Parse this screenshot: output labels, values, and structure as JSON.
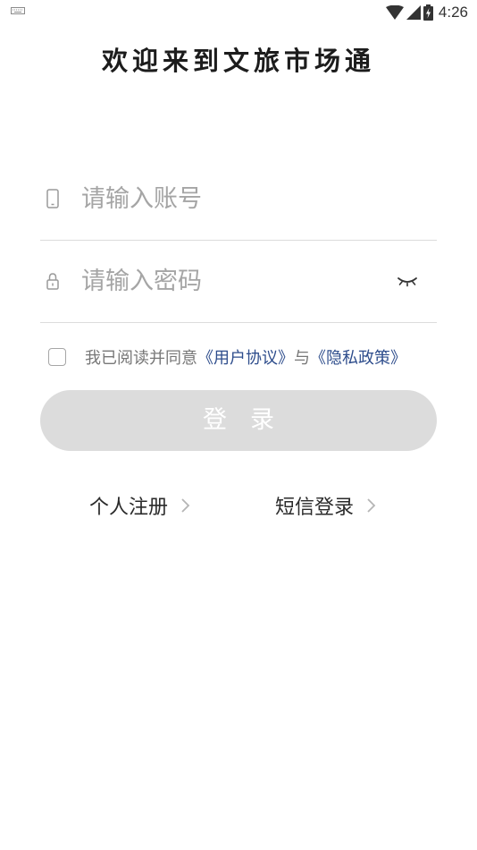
{
  "status_bar": {
    "time": "4:26"
  },
  "header": {
    "title": "欢迎来到文旅市场通"
  },
  "form": {
    "account_placeholder": "请输入账号",
    "password_placeholder": "请输入密码"
  },
  "agreement": {
    "prefix": "我已阅读并同意",
    "user_agreement": "《用户协议》",
    "conjunction": "与",
    "privacy_policy": "《隐私政策》"
  },
  "login_button": "登录",
  "links": {
    "register": "个人注册",
    "sms_login": "短信登录"
  },
  "colors": {
    "link": "#2e4d8c",
    "button_disabled": "#dcdcdc",
    "divider": "#dcdcdc",
    "placeholder": "#a5a5a5"
  }
}
